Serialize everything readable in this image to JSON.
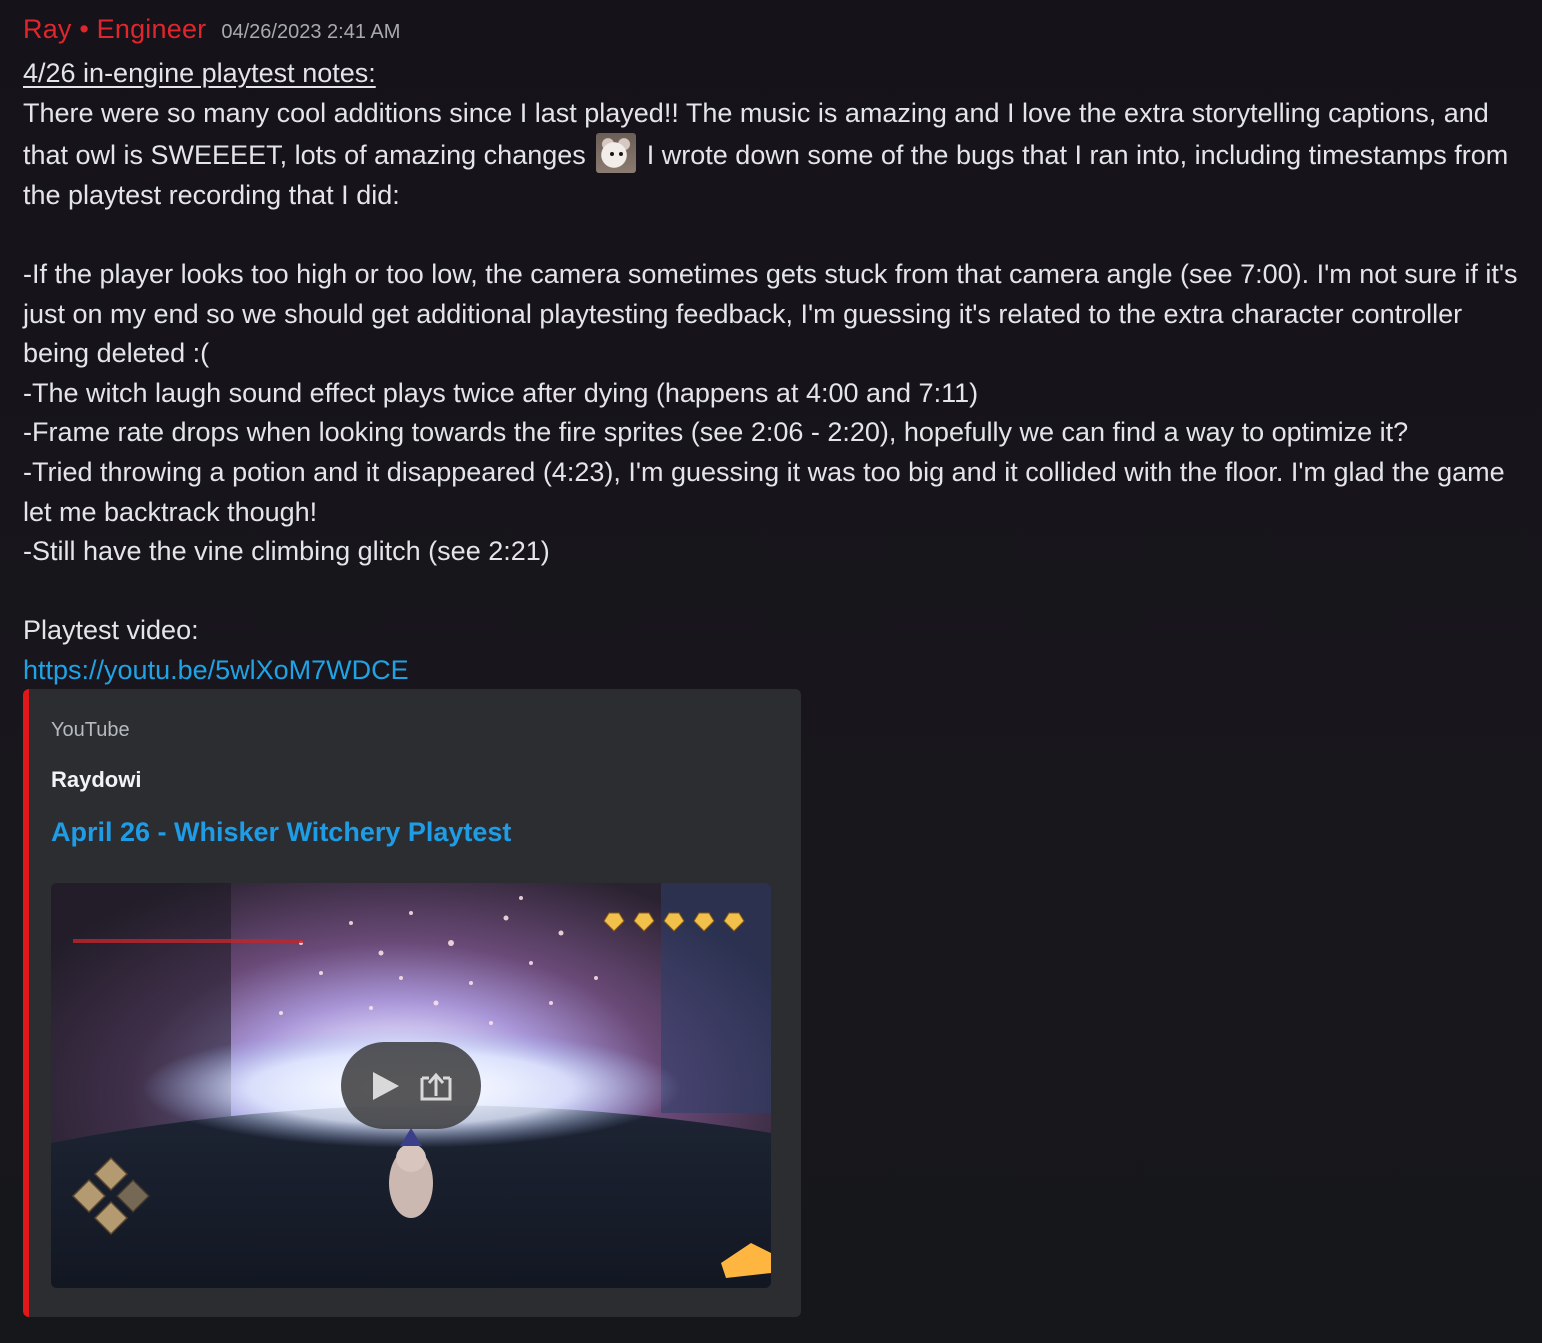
{
  "message": {
    "author": "Ray • Engineer",
    "timestamp": "04/26/2023 2:41 AM",
    "heading": "4/26 in-engine playtest notes:",
    "intro_before_emoji": "There were so many cool additions since I last played!! The music is amazing and I love the extra storytelling captions, and that owl is SWEEEET, lots of amazing changes",
    "intro_after_emoji": " I wrote down some of the bugs that I ran into, including timestamps from the playtest recording that I did:",
    "emoji": "hamster-emoji",
    "bugs": [
      "-If the player looks too high or too low, the camera sometimes gets stuck from that camera angle (see 7:00). I'm not sure if it's just on my end so we should get additional playtesting feedback, I'm guessing it's related to the extra character controller being deleted :(",
      "-The witch laugh sound effect plays twice after dying (happens at 4:00 and 7:11)",
      "-Frame rate drops when looking towards the fire sprites (see 2:06 - 2:20), hopefully we can find a way to optimize it?",
      "-Tried throwing a potion and it disappeared (4:23), I'm guessing it was too big and it collided with the floor. I'm glad the game let me backtrack though!",
      "-Still have the vine climbing glitch (see 2:21)"
    ],
    "video_label": "Playtest video:",
    "video_url": "https://youtu.be/5wlXoM7WDCE"
  },
  "embed": {
    "provider": "YouTube",
    "author": "Raydowi",
    "title": "April 26 - Whisker Witchery Playtest",
    "accent_color": "#e3161a",
    "play_icon": "play-icon",
    "open_icon": "open-external-icon"
  },
  "colors": {
    "author": "#e0262c",
    "link": "#20a3e6",
    "embed_bg": "#2b2d31"
  }
}
